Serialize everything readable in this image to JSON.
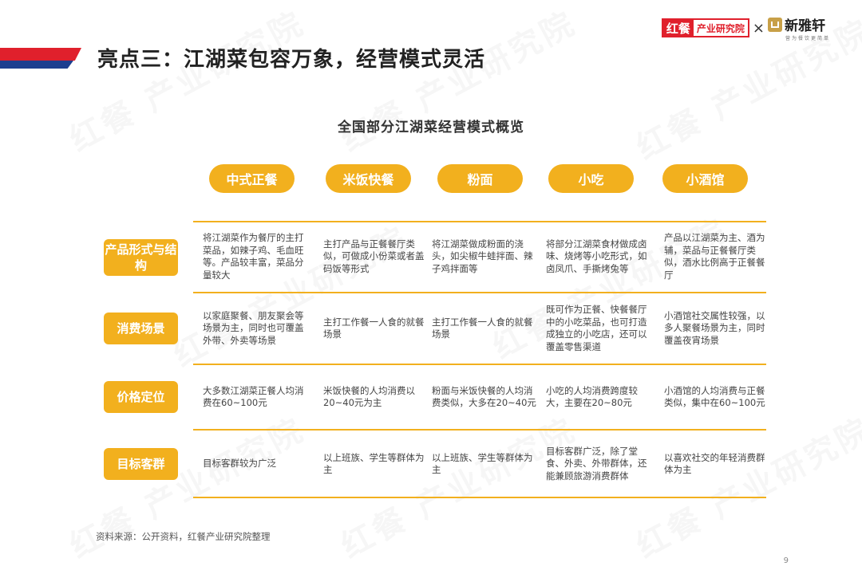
{
  "header": {
    "title": "亮点三：江湖菜包容万象，经营模式灵活",
    "logo_red_a": "红餐",
    "logo_red_b": "产业研究院",
    "logo_separator": "×",
    "logo_partner": "新雅轩",
    "logo_partner_sub": "营为餐饮更简单"
  },
  "watermark": "红餐 产业研究院",
  "table": {
    "title": "全国部分江湖菜经营模式概览",
    "columns": [
      "中式正餐",
      "米饭快餐",
      "粉面",
      "小吃",
      "小酒馆"
    ],
    "rows": [
      {
        "label": "产品形式与结构",
        "cells": [
          "将江湖菜作为餐厅的主打菜品，如辣子鸡、毛血旺等。产品较丰富，菜品分量较大",
          "主打产品与正餐餐厅类似，可做成小份菜或者盖码饭等形式",
          "将江湖菜做成粉面的浇头，如尖椒牛蛙拌面、辣子鸡拌面等",
          "将部分江湖菜食材做成卤味、烧烤等小吃形式，如卤凤爪、手撕烤兔等",
          "产品以江湖菜为主、酒为辅，菜品与正餐餐厅类似，酒水比例高于正餐餐厅"
        ]
      },
      {
        "label": "消费场景",
        "cells": [
          "以家庭聚餐、朋友聚会等场景为主，同时也可覆盖外带、外卖等场景",
          "主打工作餐一人食的就餐场景",
          "主打工作餐一人食的就餐场景",
          "既可作为正餐、快餐餐厅中的小吃菜品，也可打造成独立的小吃店，还可以覆盖零售渠道",
          "小酒馆社交属性较强，以多人聚餐场景为主，同时覆盖夜宵场景"
        ]
      },
      {
        "label": "价格定位",
        "cells": [
          "大多数江湖菜正餐人均消费在60~100元",
          "米饭快餐的人均消费以20~40元为主",
          "粉面与米饭快餐的人均消费类似，大多在20~40元",
          "小吃的人均消费跨度较大，主要在20~80元",
          "小酒馆的人均消费与正餐类似，集中在60~100元"
        ]
      },
      {
        "label": "目标客群",
        "cells": [
          "目标客群较为广泛",
          "以上班族、学生等群体为主",
          "以上班族、学生等群体为主",
          "目标客群广泛，除了堂食、外卖、外带群体，还能兼顾旅游消费群体",
          "以喜欢社交的年轻消费群体为主"
        ]
      }
    ]
  },
  "footer": {
    "source": "资料来源：公开资料，红餐产业研究院整理",
    "page_number": "9"
  },
  "colors": {
    "accent": "#f2b01e",
    "brand_red": "#e0202c",
    "brand_blue": "#1d3f8f"
  }
}
